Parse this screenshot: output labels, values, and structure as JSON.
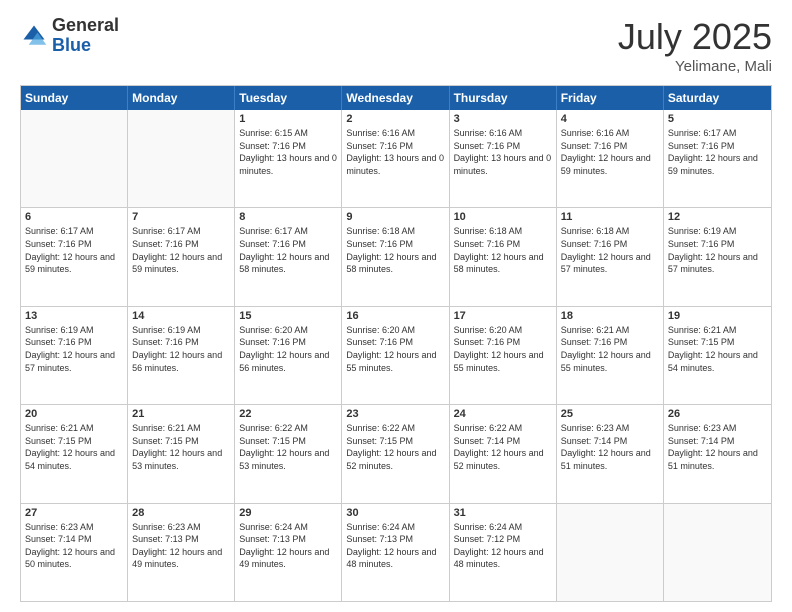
{
  "logo": {
    "general": "General",
    "blue": "Blue"
  },
  "title": {
    "month": "July 2025",
    "location": "Yelimane, Mali"
  },
  "header": {
    "days": [
      "Sunday",
      "Monday",
      "Tuesday",
      "Wednesday",
      "Thursday",
      "Friday",
      "Saturday"
    ]
  },
  "weeks": [
    [
      {
        "day": "",
        "info": ""
      },
      {
        "day": "",
        "info": ""
      },
      {
        "day": "1",
        "info": "Sunrise: 6:15 AM\nSunset: 7:16 PM\nDaylight: 13 hours and 0 minutes."
      },
      {
        "day": "2",
        "info": "Sunrise: 6:16 AM\nSunset: 7:16 PM\nDaylight: 13 hours and 0 minutes."
      },
      {
        "day": "3",
        "info": "Sunrise: 6:16 AM\nSunset: 7:16 PM\nDaylight: 13 hours and 0 minutes."
      },
      {
        "day": "4",
        "info": "Sunrise: 6:16 AM\nSunset: 7:16 PM\nDaylight: 12 hours and 59 minutes."
      },
      {
        "day": "5",
        "info": "Sunrise: 6:17 AM\nSunset: 7:16 PM\nDaylight: 12 hours and 59 minutes."
      }
    ],
    [
      {
        "day": "6",
        "info": "Sunrise: 6:17 AM\nSunset: 7:16 PM\nDaylight: 12 hours and 59 minutes."
      },
      {
        "day": "7",
        "info": "Sunrise: 6:17 AM\nSunset: 7:16 PM\nDaylight: 12 hours and 59 minutes."
      },
      {
        "day": "8",
        "info": "Sunrise: 6:17 AM\nSunset: 7:16 PM\nDaylight: 12 hours and 58 minutes."
      },
      {
        "day": "9",
        "info": "Sunrise: 6:18 AM\nSunset: 7:16 PM\nDaylight: 12 hours and 58 minutes."
      },
      {
        "day": "10",
        "info": "Sunrise: 6:18 AM\nSunset: 7:16 PM\nDaylight: 12 hours and 58 minutes."
      },
      {
        "day": "11",
        "info": "Sunrise: 6:18 AM\nSunset: 7:16 PM\nDaylight: 12 hours and 57 minutes."
      },
      {
        "day": "12",
        "info": "Sunrise: 6:19 AM\nSunset: 7:16 PM\nDaylight: 12 hours and 57 minutes."
      }
    ],
    [
      {
        "day": "13",
        "info": "Sunrise: 6:19 AM\nSunset: 7:16 PM\nDaylight: 12 hours and 57 minutes."
      },
      {
        "day": "14",
        "info": "Sunrise: 6:19 AM\nSunset: 7:16 PM\nDaylight: 12 hours and 56 minutes."
      },
      {
        "day": "15",
        "info": "Sunrise: 6:20 AM\nSunset: 7:16 PM\nDaylight: 12 hours and 56 minutes."
      },
      {
        "day": "16",
        "info": "Sunrise: 6:20 AM\nSunset: 7:16 PM\nDaylight: 12 hours and 55 minutes."
      },
      {
        "day": "17",
        "info": "Sunrise: 6:20 AM\nSunset: 7:16 PM\nDaylight: 12 hours and 55 minutes."
      },
      {
        "day": "18",
        "info": "Sunrise: 6:21 AM\nSunset: 7:16 PM\nDaylight: 12 hours and 55 minutes."
      },
      {
        "day": "19",
        "info": "Sunrise: 6:21 AM\nSunset: 7:15 PM\nDaylight: 12 hours and 54 minutes."
      }
    ],
    [
      {
        "day": "20",
        "info": "Sunrise: 6:21 AM\nSunset: 7:15 PM\nDaylight: 12 hours and 54 minutes."
      },
      {
        "day": "21",
        "info": "Sunrise: 6:21 AM\nSunset: 7:15 PM\nDaylight: 12 hours and 53 minutes."
      },
      {
        "day": "22",
        "info": "Sunrise: 6:22 AM\nSunset: 7:15 PM\nDaylight: 12 hours and 53 minutes."
      },
      {
        "day": "23",
        "info": "Sunrise: 6:22 AM\nSunset: 7:15 PM\nDaylight: 12 hours and 52 minutes."
      },
      {
        "day": "24",
        "info": "Sunrise: 6:22 AM\nSunset: 7:14 PM\nDaylight: 12 hours and 52 minutes."
      },
      {
        "day": "25",
        "info": "Sunrise: 6:23 AM\nSunset: 7:14 PM\nDaylight: 12 hours and 51 minutes."
      },
      {
        "day": "26",
        "info": "Sunrise: 6:23 AM\nSunset: 7:14 PM\nDaylight: 12 hours and 51 minutes."
      }
    ],
    [
      {
        "day": "27",
        "info": "Sunrise: 6:23 AM\nSunset: 7:14 PM\nDaylight: 12 hours and 50 minutes."
      },
      {
        "day": "28",
        "info": "Sunrise: 6:23 AM\nSunset: 7:13 PM\nDaylight: 12 hours and 49 minutes."
      },
      {
        "day": "29",
        "info": "Sunrise: 6:24 AM\nSunset: 7:13 PM\nDaylight: 12 hours and 49 minutes."
      },
      {
        "day": "30",
        "info": "Sunrise: 6:24 AM\nSunset: 7:13 PM\nDaylight: 12 hours and 48 minutes."
      },
      {
        "day": "31",
        "info": "Sunrise: 6:24 AM\nSunset: 7:12 PM\nDaylight: 12 hours and 48 minutes."
      },
      {
        "day": "",
        "info": ""
      },
      {
        "day": "",
        "info": ""
      }
    ]
  ]
}
